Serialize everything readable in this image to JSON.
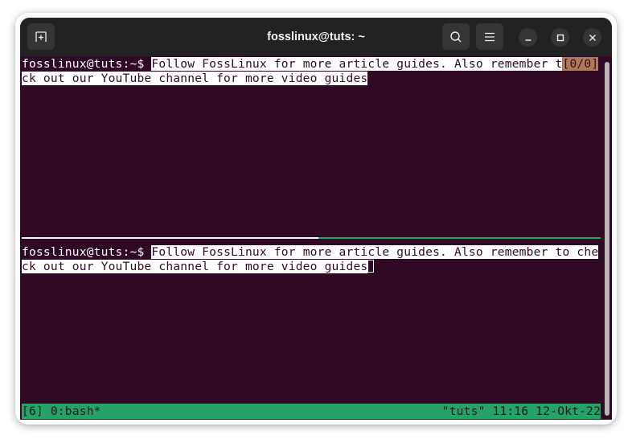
{
  "window": {
    "title": "fosslinux@tuts: ~",
    "buttons": {
      "new_tab": "new-tab-icon",
      "search": "search-icon",
      "menu": "hamburger-menu-icon",
      "minimize": "minimize-icon",
      "maximize": "maximize-icon",
      "close": "close-icon"
    }
  },
  "colors": {
    "terminal_bg": "#300a24",
    "titlebar_bg": "#222222",
    "tmux_status": "#26a269",
    "active_pane_border": "#26a269",
    "search_badge": "#b17a55"
  },
  "panes": [
    {
      "prompt": "fosslinux@tuts:~$ ",
      "line1_text": "Follow FossLinux for more article guides. Also remember t",
      "copy_mode_indicator": "[0/0]",
      "line2_text": "ck out our YouTube channel for more video guides"
    },
    {
      "prompt": "fosslinux@tuts:~$ ",
      "line1_text": "Follow FossLinux for more article guides. Also remember to che",
      "line2_text": "ck out our YouTube channel for more video guides"
    }
  ],
  "status_bar": {
    "left": "[6] 0:bash*",
    "right": "\"tuts\" 11:16 12-Okt-22"
  }
}
